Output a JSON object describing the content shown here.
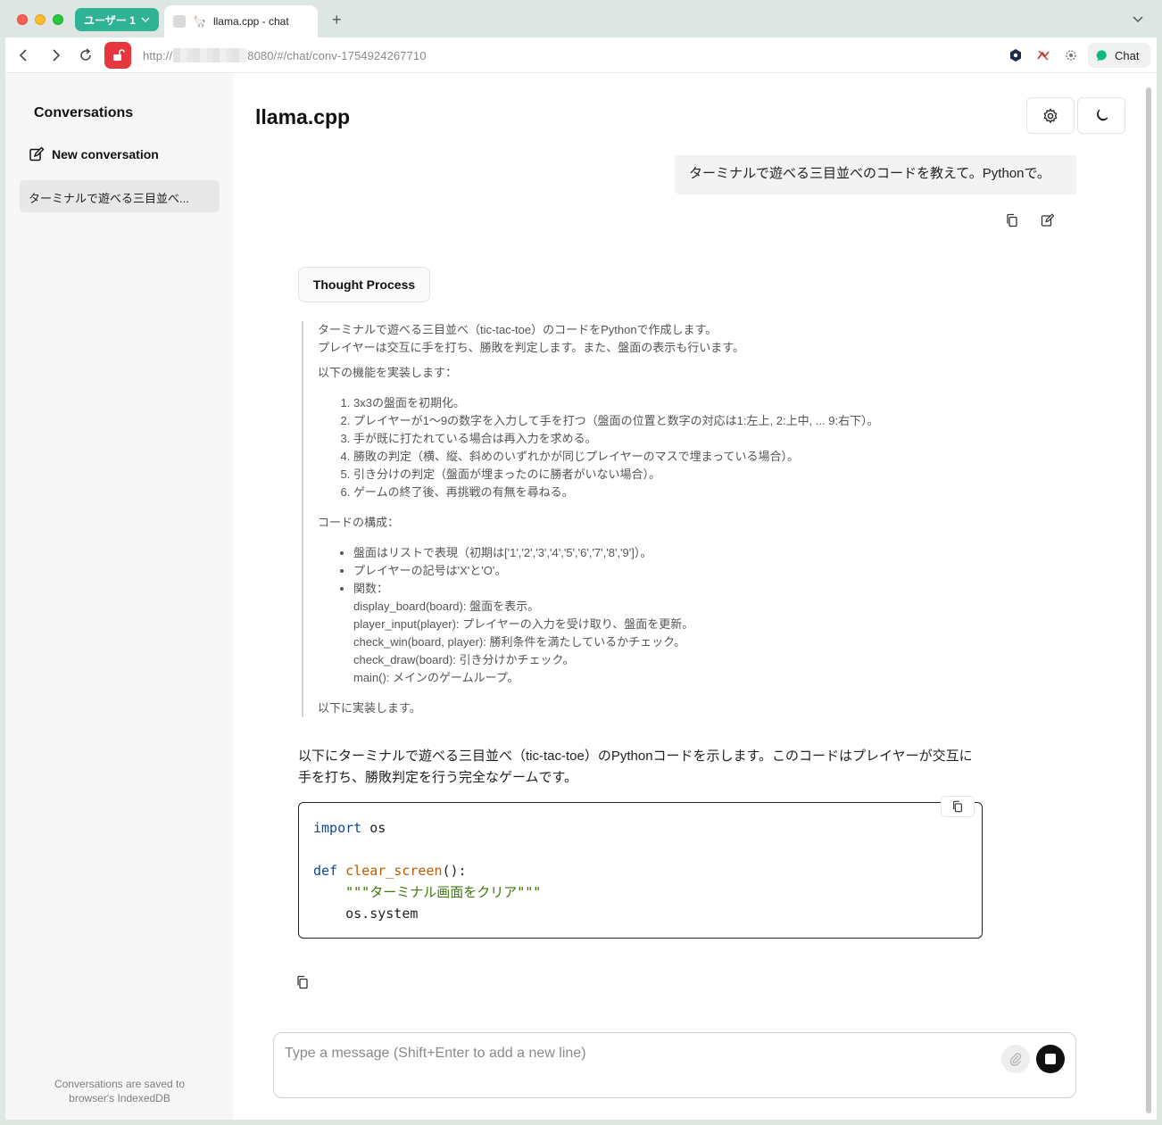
{
  "browser": {
    "profile_label": "ユーザー 1",
    "tab_title": "llama.cpp - chat",
    "tab_favicon": "🦙",
    "new_tab_symbol": "+",
    "url_prefix": "http://",
    "url_suffix": "8080/#/chat/conv-1754924267710",
    "chat_extension_label": "Chat"
  },
  "sidebar": {
    "title": "Conversations",
    "new_conversation_label": "New conversation",
    "conversations": [
      "ターミナルで遊べる三目並べ..."
    ],
    "footer_line1": "Conversations are saved to",
    "footer_line2": "browser's IndexedDB"
  },
  "header": {
    "title": "llama.cpp"
  },
  "user_message": "ターミナルで遊べる三目並べのコードを教えて。Pythonで。",
  "thought": {
    "button_label": "Thought Process",
    "intro_line1": "ターミナルで遊べる三目並べ（tic-tac-toe）のコードをPythonで作成します。",
    "intro_line2": "プレイヤーは交互に手を打ち、勝敗を判定します。また、盤面の表示も行います。",
    "features_heading": "以下の機能を実装します：",
    "features": [
      "3x3の盤面を初期化。",
      "プレイヤーが1〜9の数字を入力して手を打つ（盤面の位置と数字の対応は1:左上, 2:上中, ... 9:右下）。",
      "手が既に打たれている場合は再入力を求める。",
      "勝敗の判定（横、縦、斜めのいずれかが同じプレイヤーのマスで埋まっている場合）。",
      "引き分けの判定（盤面が埋まったのに勝者がいない場合）。",
      "ゲームの終了後、再挑戦の有無を尋ねる。"
    ],
    "structure_heading": "コードの構成：",
    "structure": [
      "盤面はリストで表現（初期は['1','2','3','4','5','6','7','8','9']）。",
      "プレイヤーの記号は'X'と'O'。",
      "関数："
    ],
    "functions": [
      "display_board(board): 盤面を表示。",
      "player_input(player): プレイヤーの入力を受け取り、盤面を更新。",
      "check_win(board, player): 勝利条件を満たしているかチェック。",
      "check_draw(board): 引き分けかチェック。",
      "main(): メインのゲームループ。"
    ],
    "closing": "以下に実装します。"
  },
  "answer": {
    "line1": "以下にターミナルで遊べる三目並べ（tic-tac-toe）のPythonコードを示します。このコードはプレイヤーが交互に",
    "line2": "手を打ち、勝敗判定を行う完全なゲームです。",
    "code": {
      "kw_import": "import",
      "mod_os": " os",
      "kw_def": "def",
      "fn_name": "clear_screen",
      "fn_tail": "():",
      "docstring": "    \"\"\"ターミナル画面をクリア\"\"\"",
      "last_line": "    os.system"
    }
  },
  "composer": {
    "placeholder": "Type a message (Shift+Enter to add a new line)"
  }
}
